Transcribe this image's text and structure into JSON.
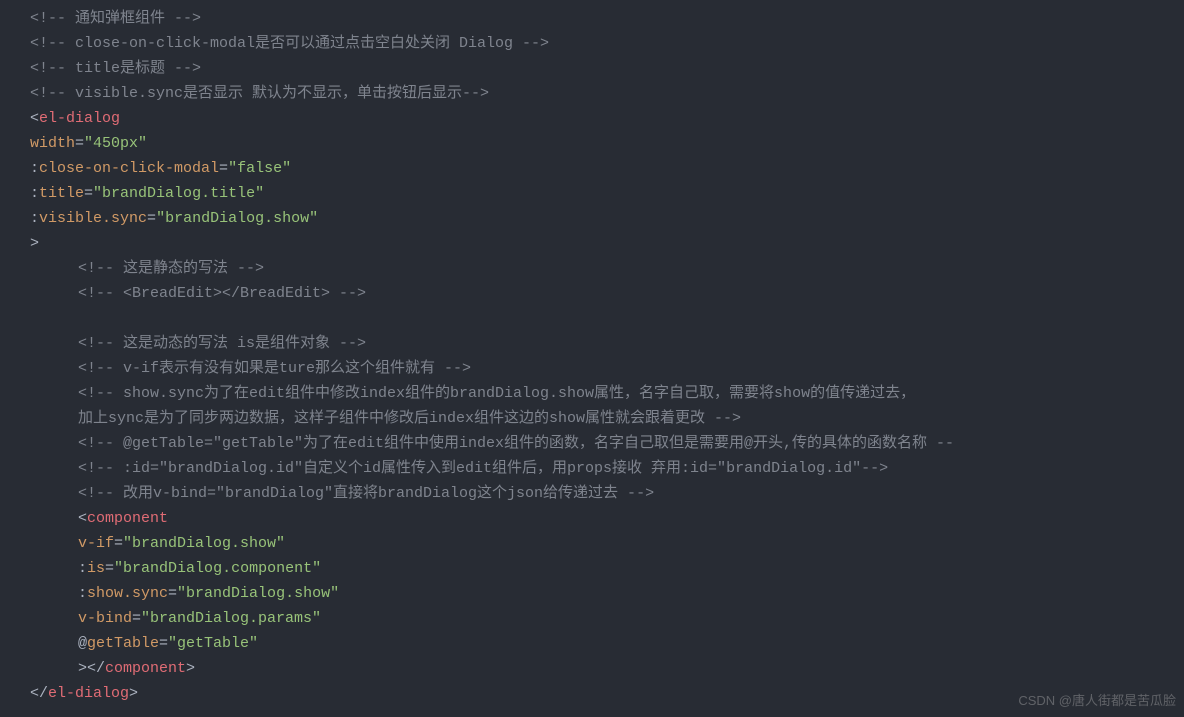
{
  "lines": [
    {
      "cls": "line",
      "tokens": [
        {
          "t": "comment",
          "v": "<!-- 通知弹框组件 -->"
        }
      ]
    },
    {
      "cls": "line",
      "tokens": [
        {
          "t": "comment",
          "v": "<!-- close-on-click-modal是否可以通过点击空白处关闭 Dialog -->"
        }
      ]
    },
    {
      "cls": "line",
      "tokens": [
        {
          "t": "comment",
          "v": "<!-- title是标题 -->"
        }
      ]
    },
    {
      "cls": "line",
      "tokens": [
        {
          "t": "comment",
          "v": "<!-- visible.sync是否显示 默认为不显示，单击按钮后显示-->"
        }
      ]
    },
    {
      "cls": "line",
      "tokens": [
        {
          "t": "tag-bracket",
          "v": "<"
        },
        {
          "t": "tag-name",
          "v": "el-dialog"
        }
      ]
    },
    {
      "cls": "line",
      "tokens": [
        {
          "t": "attr-name",
          "v": "width"
        },
        {
          "t": "equals",
          "v": "="
        },
        {
          "t": "string",
          "v": "\"450px\""
        }
      ]
    },
    {
      "cls": "line",
      "tokens": [
        {
          "t": "attr-bind",
          "v": ":"
        },
        {
          "t": "attr-name",
          "v": "close-on-click-modal"
        },
        {
          "t": "equals",
          "v": "="
        },
        {
          "t": "string",
          "v": "\"false\""
        }
      ]
    },
    {
      "cls": "line",
      "tokens": [
        {
          "t": "attr-bind",
          "v": ":"
        },
        {
          "t": "attr-name",
          "v": "title"
        },
        {
          "t": "equals",
          "v": "="
        },
        {
          "t": "string",
          "v": "\"brandDialog.title\""
        }
      ]
    },
    {
      "cls": "line",
      "tokens": [
        {
          "t": "attr-bind",
          "v": ":"
        },
        {
          "t": "attr-name",
          "v": "visible.sync"
        },
        {
          "t": "equals",
          "v": "="
        },
        {
          "t": "string",
          "v": "\"brandDialog.show\""
        }
      ]
    },
    {
      "cls": "line",
      "tokens": [
        {
          "t": "tag-bracket",
          "v": ">"
        }
      ]
    },
    {
      "cls": "indent1",
      "tokens": [
        {
          "t": "comment",
          "v": "<!-- 这是静态的写法 -->"
        }
      ]
    },
    {
      "cls": "indent1",
      "tokens": [
        {
          "t": "comment",
          "v": "<!-- <BreadEdit></BreadEdit> -->"
        }
      ]
    },
    {
      "cls": "indent1",
      "tokens": [
        {
          "t": "comment",
          "v": ""
        }
      ]
    },
    {
      "cls": "indent1",
      "tokens": [
        {
          "t": "comment",
          "v": "<!-- 这是动态的写法 is是组件对象 -->"
        }
      ]
    },
    {
      "cls": "indent1",
      "tokens": [
        {
          "t": "comment",
          "v": "<!-- v-if表示有没有如果是ture那么这个组件就有 -->"
        }
      ]
    },
    {
      "cls": "indent1",
      "tokens": [
        {
          "t": "comment",
          "v": "<!-- show.sync为了在edit组件中修改index组件的brandDialog.show属性，名字自己取，需要将show的值传递过去，"
        }
      ]
    },
    {
      "cls": "indent1",
      "tokens": [
        {
          "t": "comment",
          "v": "加上sync是为了同步两边数据，这样子组件中修改后index组件这边的show属性就会跟着更改 -->"
        }
      ]
    },
    {
      "cls": "indent1",
      "tokens": [
        {
          "t": "comment",
          "v": "<!-- @getTable=\"getTable\"为了在edit组件中使用index组件的函数，名字自己取但是需要用@开头,传的具体的函数名称 --"
        }
      ]
    },
    {
      "cls": "indent1",
      "tokens": [
        {
          "t": "comment",
          "v": "<!-- :id=\"brandDialog.id\"自定义个id属性传入到edit组件后，用props接收 弃用:id=\"brandDialog.id\"-->"
        }
      ]
    },
    {
      "cls": "indent1",
      "tokens": [
        {
          "t": "comment",
          "v": "<!-- 改用v-bind=\"brandDialog\"直接将brandDialog这个json给传递过去 -->"
        }
      ]
    },
    {
      "cls": "indent1",
      "tokens": [
        {
          "t": "tag-bracket",
          "v": "<"
        },
        {
          "t": "tag-name",
          "v": "component"
        }
      ]
    },
    {
      "cls": "indent1",
      "tokens": [
        {
          "t": "attr-name",
          "v": "v-if"
        },
        {
          "t": "equals",
          "v": "="
        },
        {
          "t": "string",
          "v": "\"brandDialog.show\""
        }
      ]
    },
    {
      "cls": "indent1",
      "tokens": [
        {
          "t": "attr-bind",
          "v": ":"
        },
        {
          "t": "attr-name",
          "v": "is"
        },
        {
          "t": "equals",
          "v": "="
        },
        {
          "t": "string",
          "v": "\"brandDialog.component\""
        }
      ]
    },
    {
      "cls": "indent1",
      "tokens": [
        {
          "t": "attr-bind",
          "v": ":"
        },
        {
          "t": "attr-name",
          "v": "show.sync"
        },
        {
          "t": "equals",
          "v": "="
        },
        {
          "t": "string",
          "v": "\"brandDialog.show\""
        }
      ]
    },
    {
      "cls": "indent1",
      "tokens": [
        {
          "t": "attr-name",
          "v": "v-bind"
        },
        {
          "t": "equals",
          "v": "="
        },
        {
          "t": "string",
          "v": "\"brandDialog.params\""
        }
      ]
    },
    {
      "cls": "indent1",
      "tokens": [
        {
          "t": "attr-bind",
          "v": "@"
        },
        {
          "t": "attr-name",
          "v": "getTable"
        },
        {
          "t": "equals",
          "v": "="
        },
        {
          "t": "string",
          "v": "\"getTable\""
        }
      ]
    },
    {
      "cls": "indent1",
      "tokens": [
        {
          "t": "tag-bracket",
          "v": ">"
        },
        {
          "t": "tag-bracket",
          "v": "</"
        },
        {
          "t": "tag-name",
          "v": "component"
        },
        {
          "t": "tag-bracket",
          "v": ">"
        }
      ]
    },
    {
      "cls": "line",
      "tokens": [
        {
          "t": "tag-bracket",
          "v": "</"
        },
        {
          "t": "tag-name",
          "v": "el-dialog"
        },
        {
          "t": "tag-bracket",
          "v": ">"
        }
      ]
    }
  ],
  "watermark": "CSDN @唐人街都是苦瓜脸"
}
